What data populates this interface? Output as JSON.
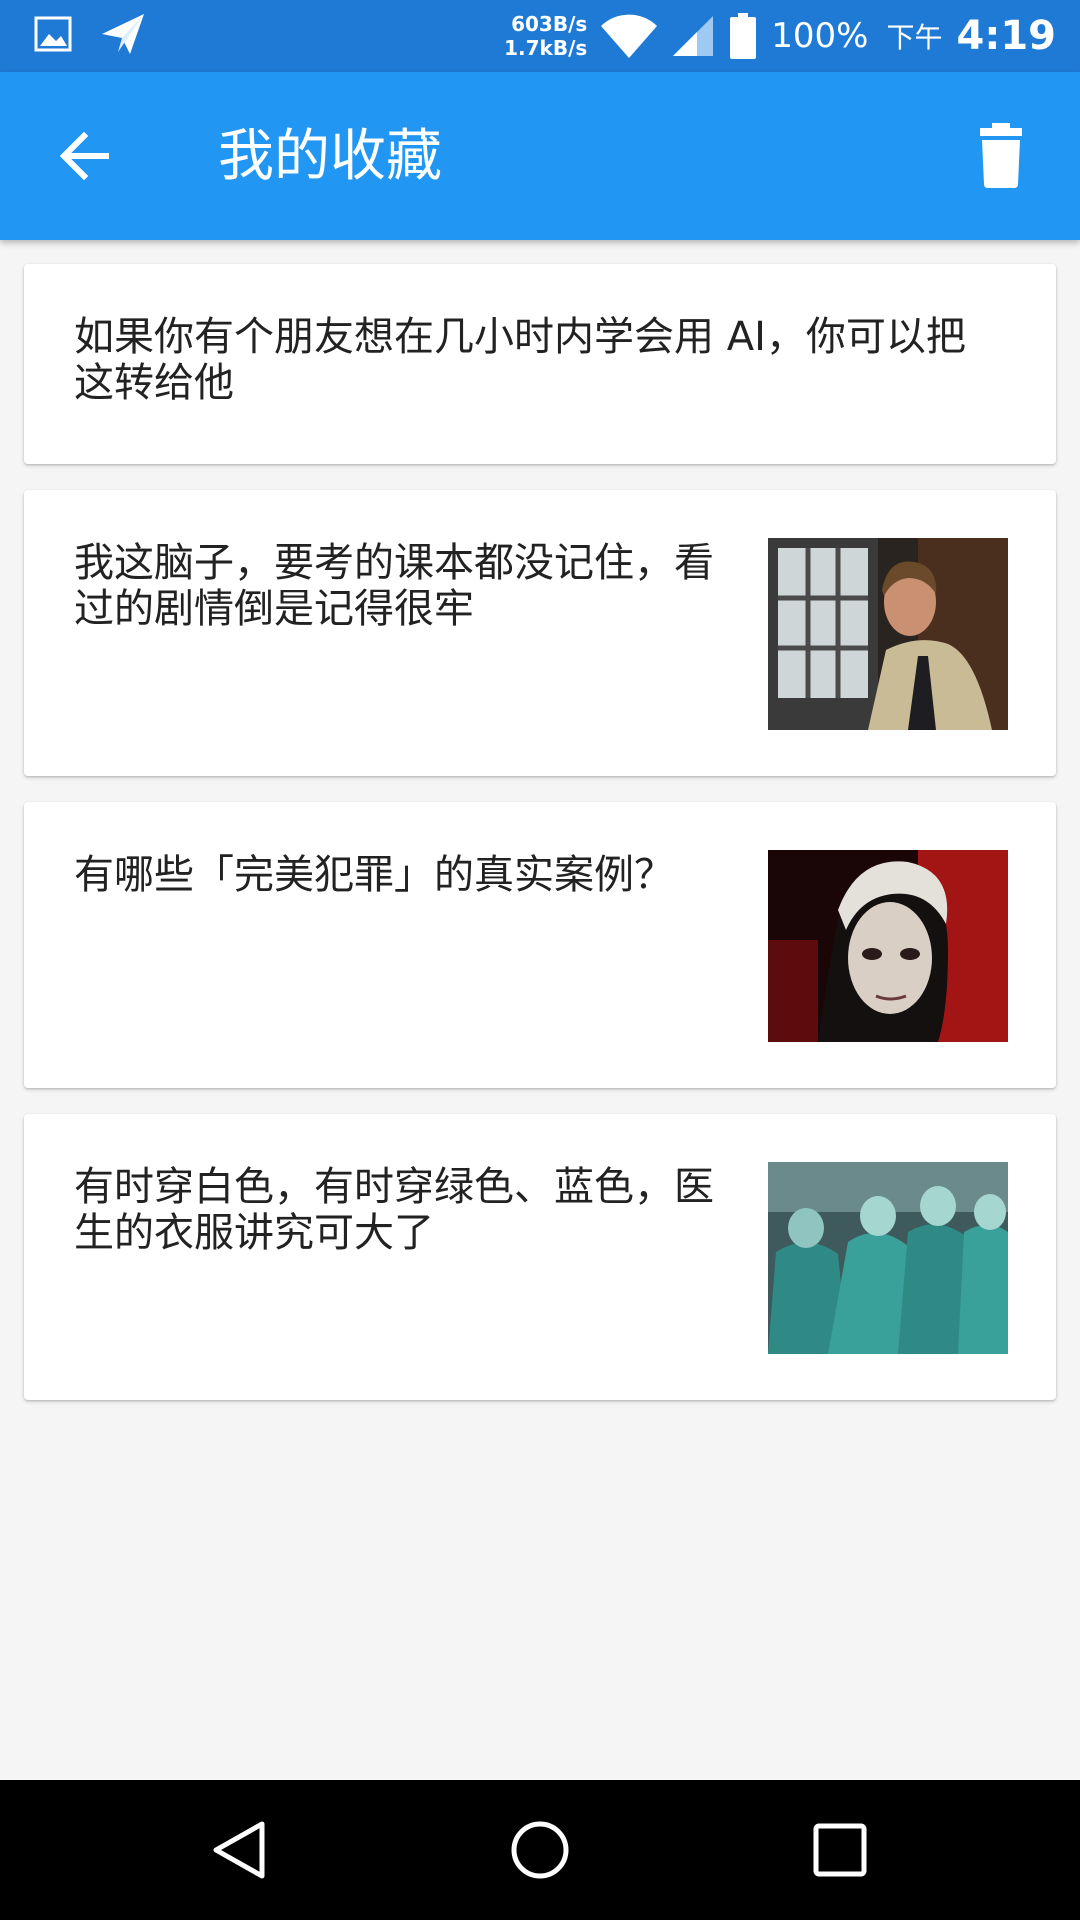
{
  "status_bar": {
    "net_up": "603B/s",
    "net_down": "1.7kB/s",
    "battery": "100%",
    "time_prefix": "下午",
    "time": "4:19",
    "icons": [
      "image-icon",
      "send-icon",
      "wifi-icon",
      "signal-icon",
      "battery-icon"
    ]
  },
  "app_bar": {
    "title": "我的收藏",
    "back_icon": "arrow-left-icon",
    "action_icon": "trash-icon",
    "color": "#2196f3"
  },
  "favorites": [
    {
      "title": "如果你有个朋友想在几小时内学会用 AI，你可以把这转给他",
      "has_image": false
    },
    {
      "title": "我这脑子，要考的课本都没记住，看过的剧情倒是记得很牢",
      "has_image": true,
      "image": "man-in-beige-jacket-photo"
    },
    {
      "title": "有哪些「完美犯罪」的真实案例？",
      "has_image": true,
      "image": "pale-face-red-background-photo"
    },
    {
      "title": "有时穿白色，有时穿绿色、蓝色，医生的衣服讲究可大了",
      "has_image": true,
      "image": "surgeons-operating-photo"
    }
  ],
  "nav_bar": {
    "icons": [
      "back-triangle-icon",
      "home-circle-icon",
      "recents-square-icon"
    ]
  }
}
